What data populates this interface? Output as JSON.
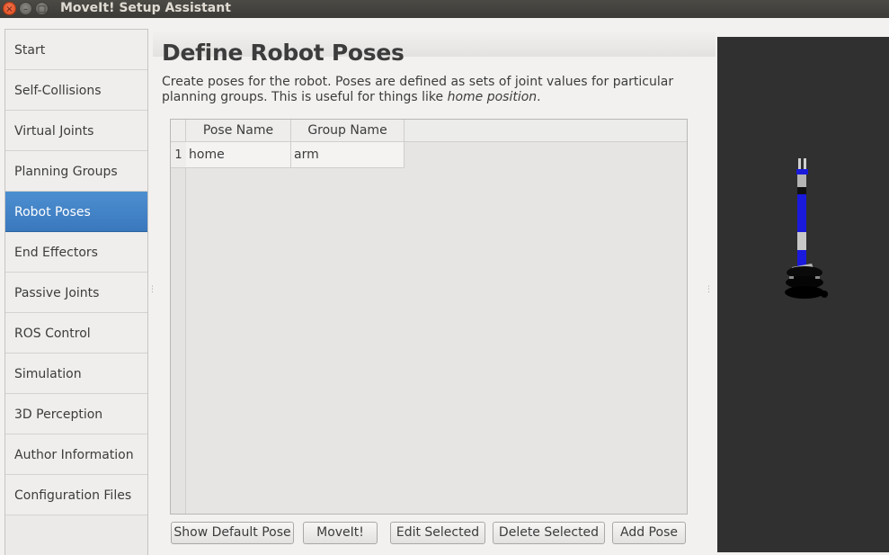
{
  "window": {
    "title": "MoveIt! Setup Assistant",
    "controls": {
      "close": "×",
      "minimize": "–",
      "maximize": "□"
    }
  },
  "nav": {
    "items": [
      {
        "label": "Start"
      },
      {
        "label": "Self-Collisions"
      },
      {
        "label": "Virtual Joints"
      },
      {
        "label": "Planning Groups"
      },
      {
        "label": "Robot Poses"
      },
      {
        "label": "End Effectors"
      },
      {
        "label": "Passive Joints"
      },
      {
        "label": "ROS Control"
      },
      {
        "label": "Simulation"
      },
      {
        "label": "3D Perception"
      },
      {
        "label": "Author Information"
      },
      {
        "label": "Configuration Files"
      }
    ],
    "active_label": "Robot Poses"
  },
  "page": {
    "title": "Define Robot Poses",
    "description_prefix": "Create poses for the robot. Poses are defined as sets of joint values for particular planning groups. This is useful for things like ",
    "description_emphasis": "home position",
    "description_suffix": "."
  },
  "table": {
    "columns": [
      "Pose Name",
      "Group Name"
    ],
    "rows": [
      {
        "index": "1",
        "pose_name": "home",
        "group_name": "arm"
      }
    ]
  },
  "buttons": {
    "show_default_pose": "Show Default Pose",
    "moveit": "MoveIt!",
    "edit_selected": "Edit Selected",
    "delete_selected": "Delete Selected",
    "add_pose": "Add Pose"
  },
  "colors": {
    "nav_active": "#3a78bd",
    "viewer_background": "#303030",
    "robot_link_blue": "#1a1adc",
    "robot_link_gray": "#b4b4b4"
  }
}
